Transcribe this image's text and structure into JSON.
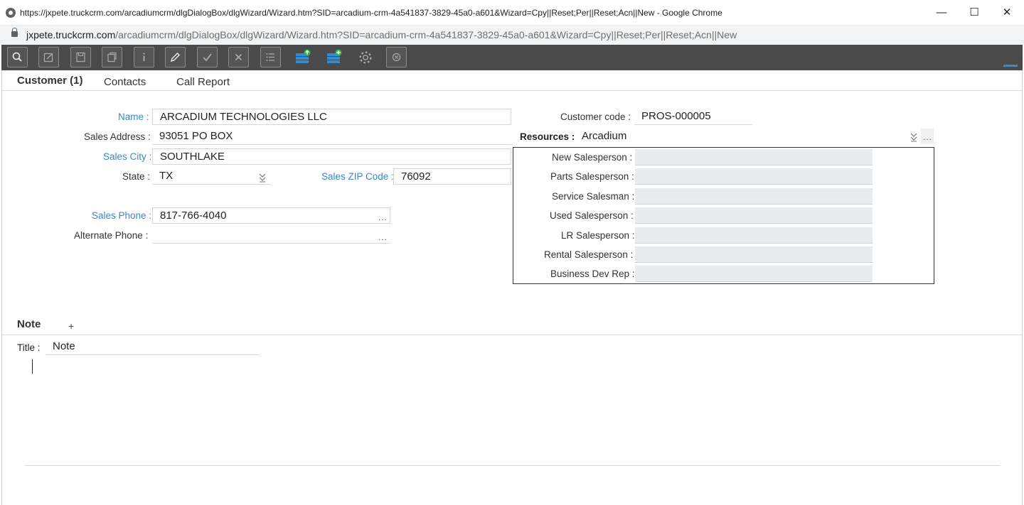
{
  "browser": {
    "title": "https://jxpete.truckcrm.com/arcadiumcrm/dlgDialogBox/dlgWizard/Wizard.htm?SID=arcadium-crm-4a541837-3829-45a0-a601&Wizard=Cpy||Reset;Per||Reset;Acn||New - Google Chrome",
    "url_host": "jxpete.truckcrm.com",
    "url_path": "/arcadiumcrm/dlgDialogBox/dlgWizard/Wizard.htm?SID=arcadium-crm-4a541837-3829-45a0-a601&Wizard=Cpy||Reset;Per||Reset;Acn||New",
    "minimize": "—",
    "maximize": "☐",
    "close": "✕"
  },
  "toolbar": {
    "icons": [
      "search-icon",
      "edit-icon",
      "save-icon",
      "copy-icon",
      "info-icon",
      "pencil-icon",
      "check-icon",
      "cancel-icon",
      "list-icon",
      "upload-db-icon",
      "add-db-icon",
      "settings-icon",
      "close-circle-icon"
    ],
    "accent": "#2e8bd6",
    "green": "#35b34a"
  },
  "tabs": [
    {
      "label": "Customer (1)",
      "active": true
    },
    {
      "label": "Contacts",
      "active": false
    },
    {
      "label": "Call Report",
      "active": false
    }
  ],
  "form": {
    "name_label": "Name :",
    "name_value": "ARCADIUM TECHNOLOGIES LLC",
    "sales_address_label": "Sales Address :",
    "sales_address_value": "93051 PO BOX",
    "sales_city_label": "Sales City :",
    "sales_city_value": "SOUTHLAKE",
    "state_label": "State :",
    "state_value": "TX",
    "zip_label": "Sales ZIP Code :",
    "zip_value": "76092",
    "sales_phone_label": "Sales Phone :",
    "sales_phone_value": "817-766-4040",
    "alt_phone_label": "Alternate Phone :",
    "alt_phone_value": "",
    "customer_code_label": "Customer code :",
    "customer_code_value": "PROS-000005",
    "resources_label": "Resources :",
    "resources_value": "Arcadium",
    "ellipsis": "..."
  },
  "salespersons": [
    {
      "label": "New Salesperson :",
      "value": ""
    },
    {
      "label": "Parts Salesperson :",
      "value": ""
    },
    {
      "label": "Service Salesman :",
      "value": ""
    },
    {
      "label": "Used Salesperson :",
      "value": ""
    },
    {
      "label": "LR Salesperson :",
      "value": ""
    },
    {
      "label": "Rental Salesperson :",
      "value": ""
    },
    {
      "label": "Business Dev Rep :",
      "value": ""
    }
  ],
  "note": {
    "heading": "Note",
    "add": "+",
    "title_label": "Title :",
    "title_value": "Note"
  }
}
